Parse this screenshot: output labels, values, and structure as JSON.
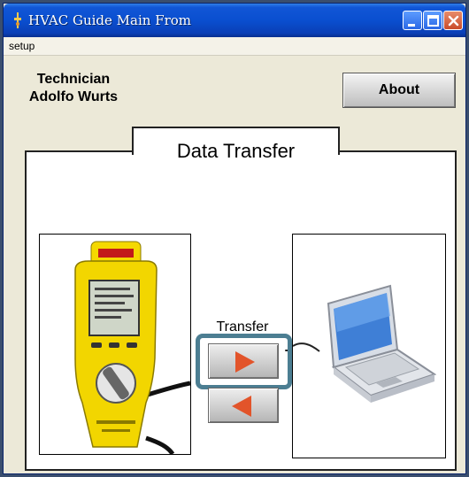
{
  "window": {
    "title": "HVAC Guide Main From"
  },
  "menu": {
    "items": [
      "setup"
    ]
  },
  "technician": {
    "label": "Technician",
    "name": "Adolfo Wurts"
  },
  "about_button": {
    "label": "About"
  },
  "panel": {
    "title": "Data Transfer",
    "transfer_label": "Transfer",
    "send_icon": "arrow-right-icon",
    "receive_icon": "arrow-left-icon",
    "arrow_color": "#e2542a",
    "frame_color": "#4c7e92"
  },
  "images": {
    "meter": "hvac-meter-image",
    "laptop": "laptop-image"
  }
}
